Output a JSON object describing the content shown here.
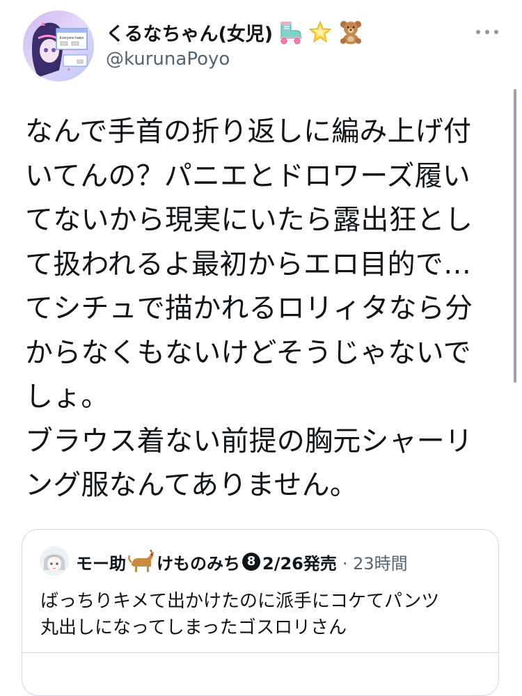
{
  "author": {
    "display_name": "くるなちゃん(女児)",
    "name_emojis": [
      "roller-skate-icon",
      "glowing-star-icon",
      "teddy-bear-icon"
    ],
    "handle": "@kurunaPoyo",
    "avatar_caption": "Everyone hates"
  },
  "tweet": {
    "lines": [
      "なんで手首の折り返しに編み上げ付",
      "いてんの？パニエとドロワーズ履い",
      "てないから現実にいたら露出狂とし",
      "て扱われるよ最初からエロ目的で…",
      "てシチュで描かれるロリィタなら分",
      "からなくもないけどそうじゃないで",
      "しょ。",
      "ブラウス着ない前提の胸元シャーリ",
      "ング服なんてありません。"
    ]
  },
  "quote": {
    "name_prefix": "モー助",
    "name_suffix": "けものみち",
    "badge": "8",
    "release": "2/26発売",
    "time": "· 23時間",
    "lines": [
      "ばっちりキメて出かけたのに派手にコケてパンツ",
      "丸出しになってしまったゴスロリさん"
    ]
  },
  "colors": {
    "text": "#0f1419",
    "secondary": "#536471",
    "border": "#cfd9de"
  }
}
